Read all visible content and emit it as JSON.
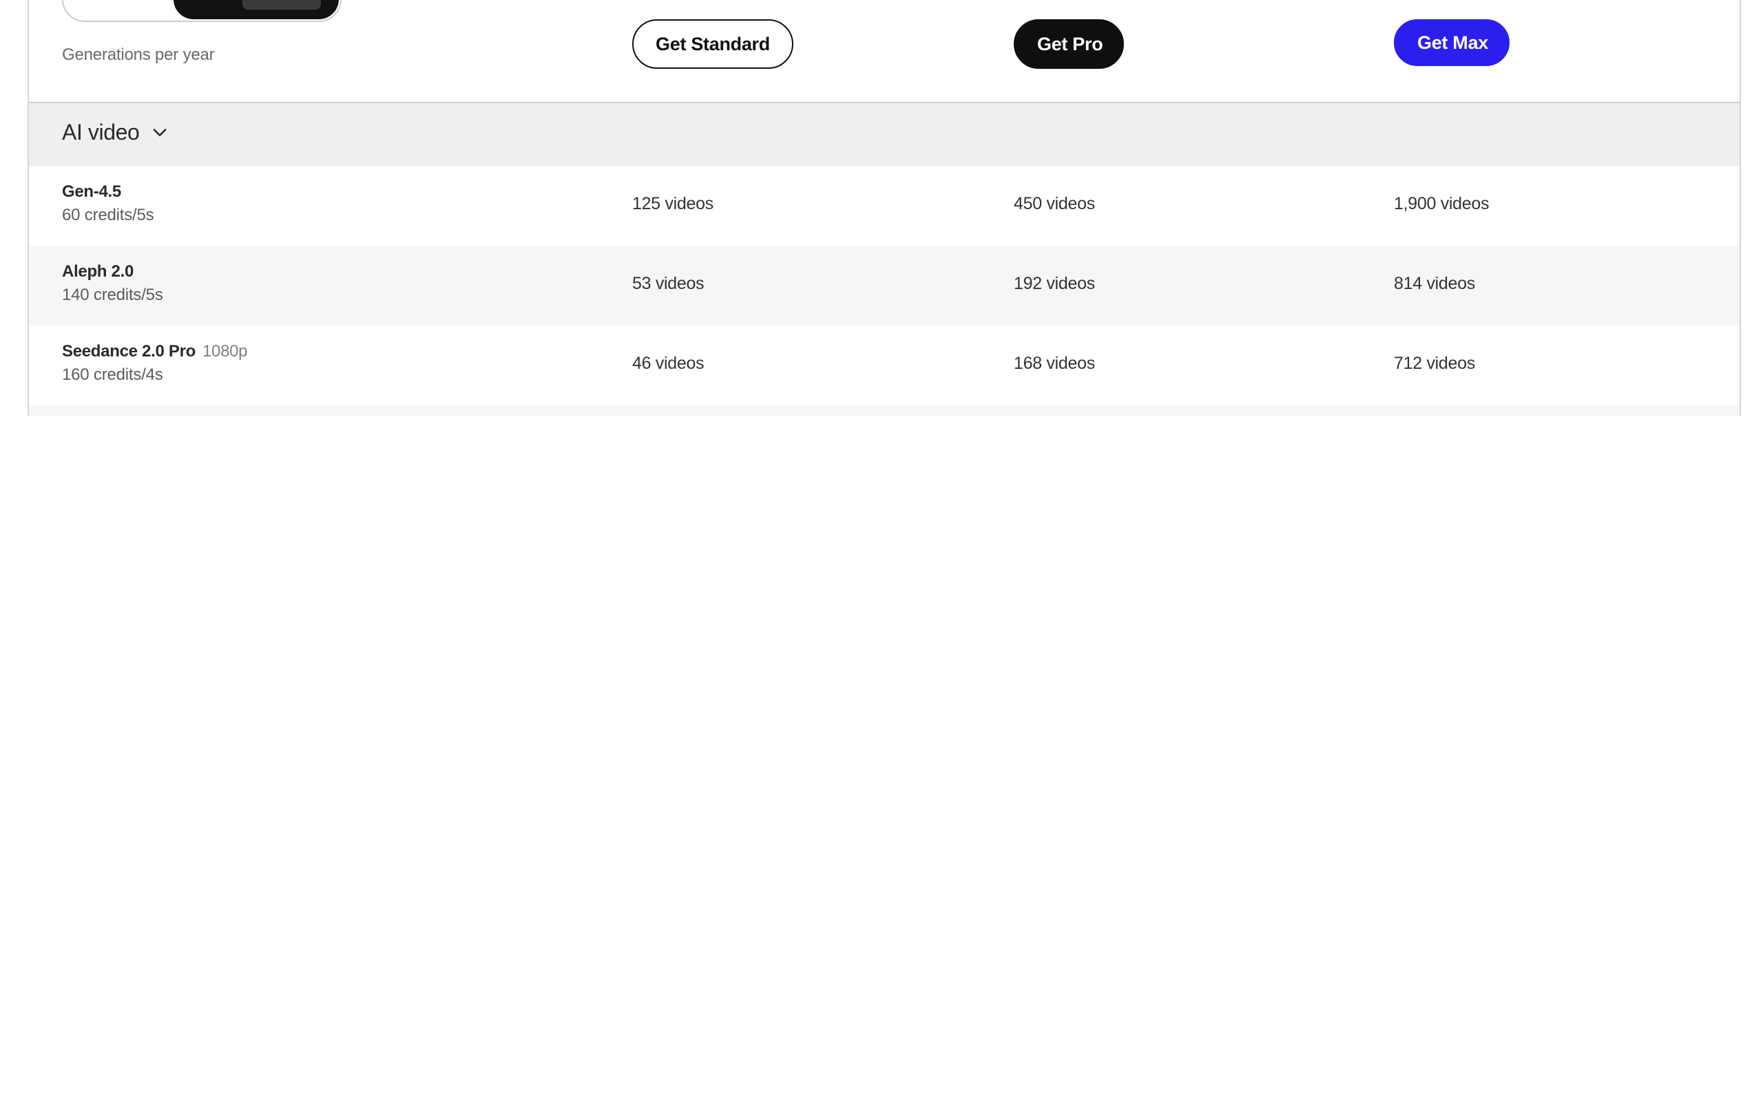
{
  "header": {
    "generations_label": "Generations per year",
    "cta_standard": "Get Standard",
    "cta_pro": "Get Pro",
    "cta_max": "Get Max",
    "accent_color": "#2b1ff0"
  },
  "section": {
    "title": "AI video",
    "icon": "chevron-down-icon"
  },
  "rows": [
    {
      "model": "Gen-4.5",
      "resolution": "",
      "credits": "60 credits/5s",
      "standard": "125 videos",
      "pro": "450 videos",
      "max": "1,900 videos"
    },
    {
      "model": "Aleph 2.0",
      "resolution": "",
      "credits": "140 credits/5s",
      "standard": "53 videos",
      "pro": "192 videos",
      "max": "814 videos"
    },
    {
      "model": "Seedance 2.0 Pro",
      "resolution": "1080p",
      "credits": "160 credits/4s",
      "standard": "46 videos",
      "pro": "168 videos",
      "max": "712 videos"
    }
  ]
}
